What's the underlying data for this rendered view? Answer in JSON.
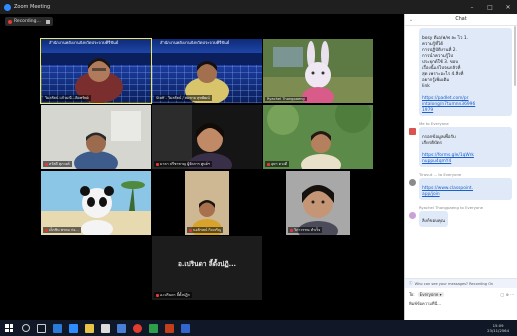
{
  "window": {
    "title": "Zoom Meeting",
    "min": "–",
    "max": "□",
    "close": "✕"
  },
  "recording": {
    "label": "Recording..."
  },
  "participants": [
    {
      "name": "วิมลรัตน์ แก้วมณี...คิดทรัพย์",
      "strip": "สำนักงานพลังงานจังหวัดประจวบคีรีขันธ์"
    },
    {
      "name": "Staff - วิมลรัตน์ / สมชาย สุขพัฒน์",
      "strip": "สำนักงานพลังงานจังหวัดประจวบคีรีขันธ์"
    },
    {
      "name": "Ryachel Thongpaeng"
    },
    {
      "name": "สวัสดี ศุภวงศ์"
    },
    {
      "name": "มาลา ปรีชาชาญ ผู้จัดการ ศูนย์ฯ"
    },
    {
      "name": "อุษา ดวงดี"
    },
    {
      "name": "เด็กชิน พรหม ก่อ..."
    },
    {
      "name": "นงลักษณ์ กิจเจริญ"
    },
    {
      "name": "วิภาวรรณ สำเร็จ"
    },
    {
      "name": "อ.เปรินดา ลี้ตั้งปฏิก",
      "avatar_text": "อ.เปรินดา ลี้ตั้งปฏิ..."
    }
  ],
  "chat": {
    "title": "Chat",
    "first_message": "bosy ดีเอ/ฟ/ฟ ละ ไว 1.\nความรู้ที่ได้\nการปฏิบัติงานที่ 2.\nการนำความรู้ไป\nประยุกต์ใช้ 3. ขอบ\nเรื่องนี้แก่ไปจนกลัวที่\nสุด เพราะอะไร 4.สิ่งที่\nอยากรู้เพิ่มเติม\nlink",
    "first_link": "https://padlet.com/pr\nintalong/n7tumnn36996\n1979",
    "msg2_from": "Me to Everyone",
    "msg2_text": "กรอกข้อมูลเพื่อรับ\nเกียรติบัตร",
    "msg2_link": "https://forms.gle/1qWrk\nnuppu4qmY4",
    "msg3_from": "Tiravut ... to Everyone",
    "msg3_link": "https://www.classpoint.\napp/join",
    "msg4_from": "Ryachel Thongpaeng to Everyone",
    "msg4_text": "ลิงก์ขอบคุณ",
    "notice": "Who can see your messages? Recording On",
    "to_label": "To:",
    "to_value": "Everyone ▾",
    "tools": "▢ ⊕ ···",
    "input_text": "พิมพ์ข้อความที่นี่..."
  },
  "taskbar": {
    "time": "15:09",
    "date": "23/11/2564"
  },
  "colors": {
    "accent": "#2d8cff",
    "active_speaker": "#f2e85b",
    "record": "#e53935"
  }
}
